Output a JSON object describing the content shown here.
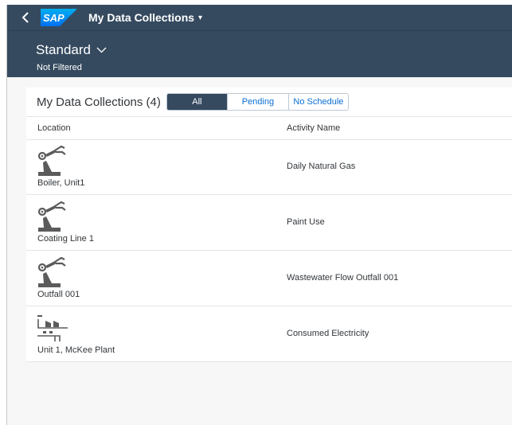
{
  "shellbar": {
    "back_icon": "chevron-left-icon",
    "logo_text": "SAP",
    "app_title": "My Data Collections",
    "title_caret": "▾"
  },
  "variant": {
    "name": "Standard",
    "filter_status": "Not Filtered"
  },
  "table": {
    "title": "My Data Collections (4)",
    "filters": [
      {
        "label": "All",
        "active": true
      },
      {
        "label": "Pending",
        "active": false
      },
      {
        "label": "No Schedule",
        "active": false
      }
    ],
    "columns": [
      "Location",
      "Activity Name"
    ],
    "rows": [
      {
        "icon": "robot-arm-icon",
        "location": "Boiler, Unit1",
        "activity": "Daily Natural Gas"
      },
      {
        "icon": "robot-arm-icon",
        "location": "Coating Line 1",
        "activity": "Paint Use"
      },
      {
        "icon": "robot-arm-icon",
        "location": "Outfall 001",
        "activity": "Wastewater Flow Outfall 001"
      },
      {
        "icon": "factory-icon",
        "location": "Unit 1, McKee Plant",
        "activity": "Consumed Electricity"
      }
    ]
  },
  "colors": {
    "shell": "#354a5f",
    "accent": "#0a6ed1",
    "logo_blue": "#0070f2",
    "icon_gray": "#5b5b5b"
  }
}
